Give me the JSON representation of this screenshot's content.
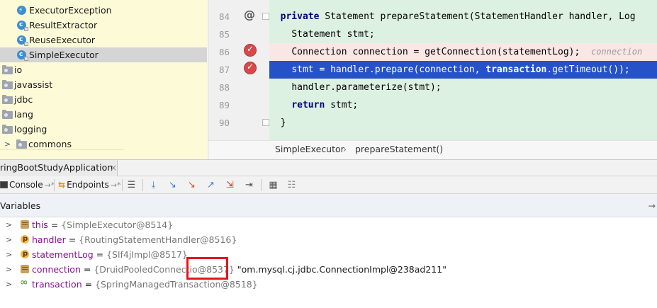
{
  "project_tree": {
    "items": [
      {
        "label": "ExecutorException",
        "icon": "exception-class-icon",
        "selected": false
      },
      {
        "label": "ResultExtractor",
        "icon": "class-icon",
        "selected": false
      },
      {
        "label": "ReuseExecutor",
        "icon": "class-icon",
        "selected": false
      },
      {
        "label": "SimpleExecutor",
        "icon": "class-icon",
        "selected": true
      },
      {
        "label": "io",
        "icon": "package-icon"
      },
      {
        "label": "javassist",
        "icon": "package-icon"
      },
      {
        "label": "jdbc",
        "icon": "package-icon"
      },
      {
        "label": "lang",
        "icon": "package-icon"
      },
      {
        "label": "logging",
        "icon": "package-icon"
      },
      {
        "label": "commons",
        "icon": "package-icon"
      }
    ]
  },
  "editor": {
    "line_numbers": [
      "84",
      "85",
      "86",
      "87",
      "88",
      "89",
      "90"
    ],
    "lines": {
      "l84_kw": "private",
      "l84_rest": " Statement prepareStatement(StatementHandler handler, Log",
      "l85": "Statement stmt;",
      "l86": "Connection connection = getConnection(statementLog);",
      "l86_hint": "connection",
      "l87_a": "stmt = handler.prepare(connection, ",
      "l87_kw": "transaction",
      "l87_b": ".getTimeout());",
      "l88": "handler.parameterize(stmt);",
      "l89_kw": "return",
      "l89_rest": " stmt;",
      "l90": "}"
    },
    "breadcrumb": {
      "file": "SimpleExecutor",
      "separator": "›",
      "method": "prepareStatement()"
    }
  },
  "debug": {
    "run_config": "ringBootStudyApplication",
    "close_glyph": "×",
    "tabs": {
      "console": "Console",
      "endpoints": "Endpoints",
      "pin": "→*"
    },
    "variables_title": "Variables",
    "variables_pin": "→",
    "variables": [
      {
        "name": "this",
        "icon": "field-icon",
        "equals": " = ",
        "value": "{SimpleExecutor@8514}",
        "string": ""
      },
      {
        "name": "handler",
        "icon": "parameter-icon",
        "equals": " = ",
        "value": "{RoutingStatementHandler@8516}",
        "string": ""
      },
      {
        "name": "statementLog",
        "icon": "parameter-icon",
        "equals": " = ",
        "value": "{Slf4jImpl@8517}",
        "string": ""
      },
      {
        "name": "connection",
        "icon": "field-icon",
        "equals": " = ",
        "value": "{DruidPooledConnectio",
        "value_hl": "@8537}",
        "string": " \"om.mysql.cj.jdbc.ConnectionImpl@238ad211\""
      },
      {
        "name": "transaction",
        "icon": "watch-icon",
        "equals": " = ",
        "value": "{SpringManagedTransaction@8518}",
        "string": ""
      }
    ]
  },
  "colors": {
    "exec_line": "#2553c7",
    "breakpoint": "#d64a4a",
    "highlight_box": "#e6151c",
    "tree_bg": "#fdfbd7",
    "code_bg": "#ddf1e2"
  }
}
